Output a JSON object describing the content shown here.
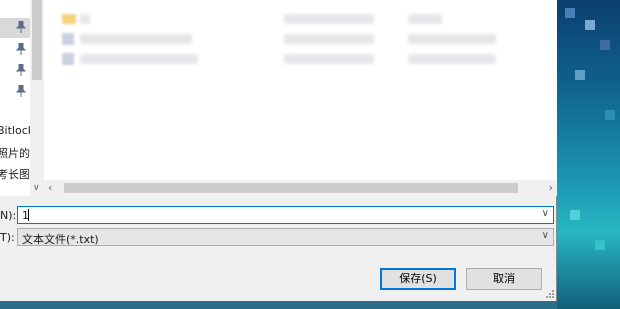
{
  "nav": {
    "items": [
      {
        "label": "Bitlock"
      },
      {
        "label": "照片的("
      },
      {
        "label": "考长图("
      }
    ]
  },
  "form": {
    "filename_label": "N):",
    "filename_value": "1",
    "filetype_label": "T):",
    "filetype_value": "文本文件(*.txt)"
  },
  "buttons": {
    "save": "保存(S)",
    "cancel": "取消"
  },
  "colors": {
    "accent": "#0078d7",
    "dialog_bg": "#f0f0f0",
    "button_bg": "#e1e1e1"
  },
  "icons": {
    "pin": "pin-icon",
    "dropdown": "chevron-down-icon",
    "scroll_left": "chevron-left-icon",
    "scroll_right": "chevron-right-icon"
  }
}
